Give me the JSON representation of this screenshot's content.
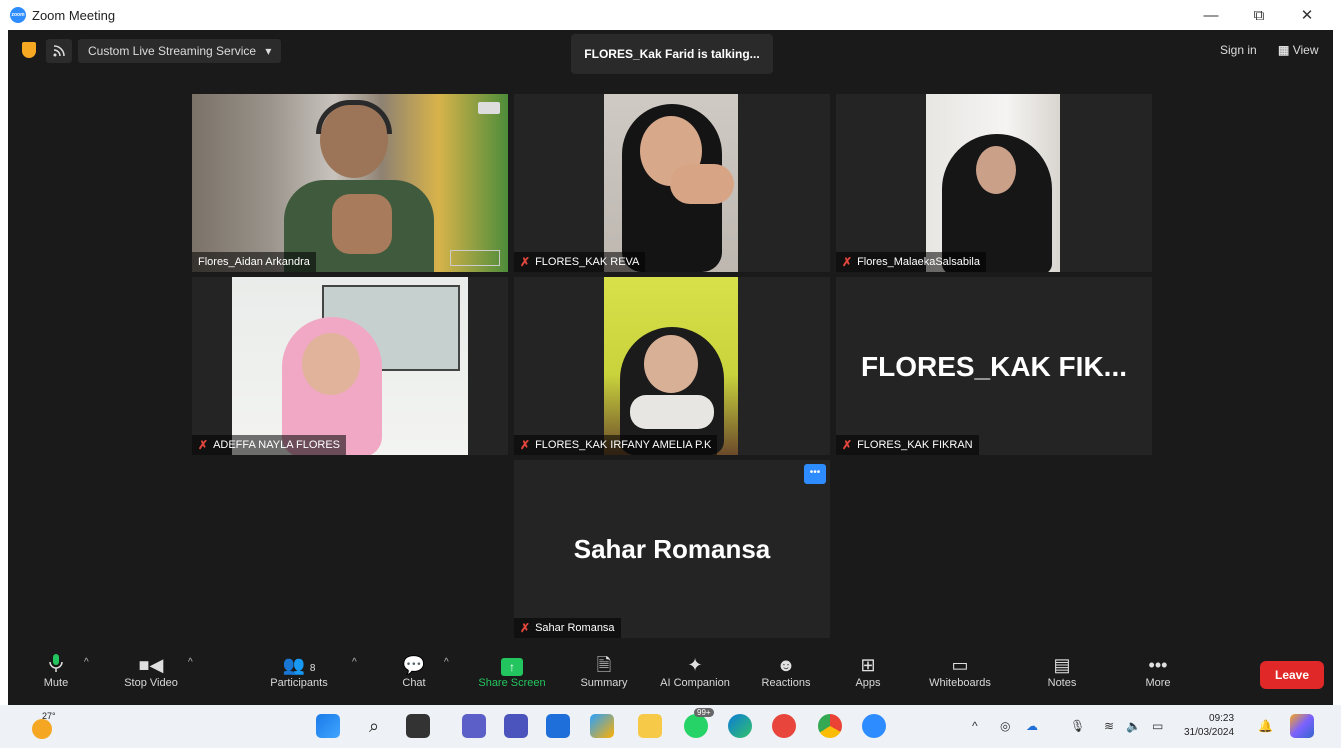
{
  "window": {
    "title": "Zoom Meeting",
    "logo_text": "zoom",
    "controls": {
      "minimize": "—",
      "restore": "⧉",
      "close": "✕"
    }
  },
  "topbar": {
    "stream_label": "Custom Live Streaming Service",
    "stream_caret": "▾",
    "talking_text": "FLORES_Kak Farid is talking...",
    "signin_label": "Sign in",
    "view_label": "View"
  },
  "tiles": [
    {
      "name": "Flores_Aidan Arkandra",
      "muted": false
    },
    {
      "name": "FLORES_KAK REVA",
      "muted": true
    },
    {
      "name": "Flores_MalaekaSalsabila",
      "muted": true
    },
    {
      "name": "ADEFFA NAYLA FLORES",
      "muted": true
    },
    {
      "name": "FLORES_KAK IRFANY AMELIA P.K",
      "muted": true
    },
    {
      "name": "FLORES_KAK FIKRAN",
      "muted": true,
      "big_name": "FLORES_KAK  FIK..."
    },
    {
      "name": "Sahar Romansa",
      "muted": true,
      "big_name": "Sahar Romansa"
    }
  ],
  "toolbar": {
    "mute": "Mute",
    "stop_video": "Stop Video",
    "participants": "Participants",
    "participants_count": "8",
    "chat": "Chat",
    "share_screen": "Share Screen",
    "summary": "Summary",
    "ai_companion": "AI Companion",
    "reactions": "Reactions",
    "apps": "Apps",
    "whiteboards": "Whiteboards",
    "notes": "Notes",
    "more": "More",
    "leave": "Leave"
  },
  "taskbar": {
    "temperature": "27°",
    "whatsapp_badge": "99+",
    "time": "09:23",
    "date": "31/03/2024"
  },
  "colors": {
    "accent": "#2d8cff",
    "leave": "#e02828",
    "share": "#23c55e",
    "muted_mic": "#e0463c"
  }
}
